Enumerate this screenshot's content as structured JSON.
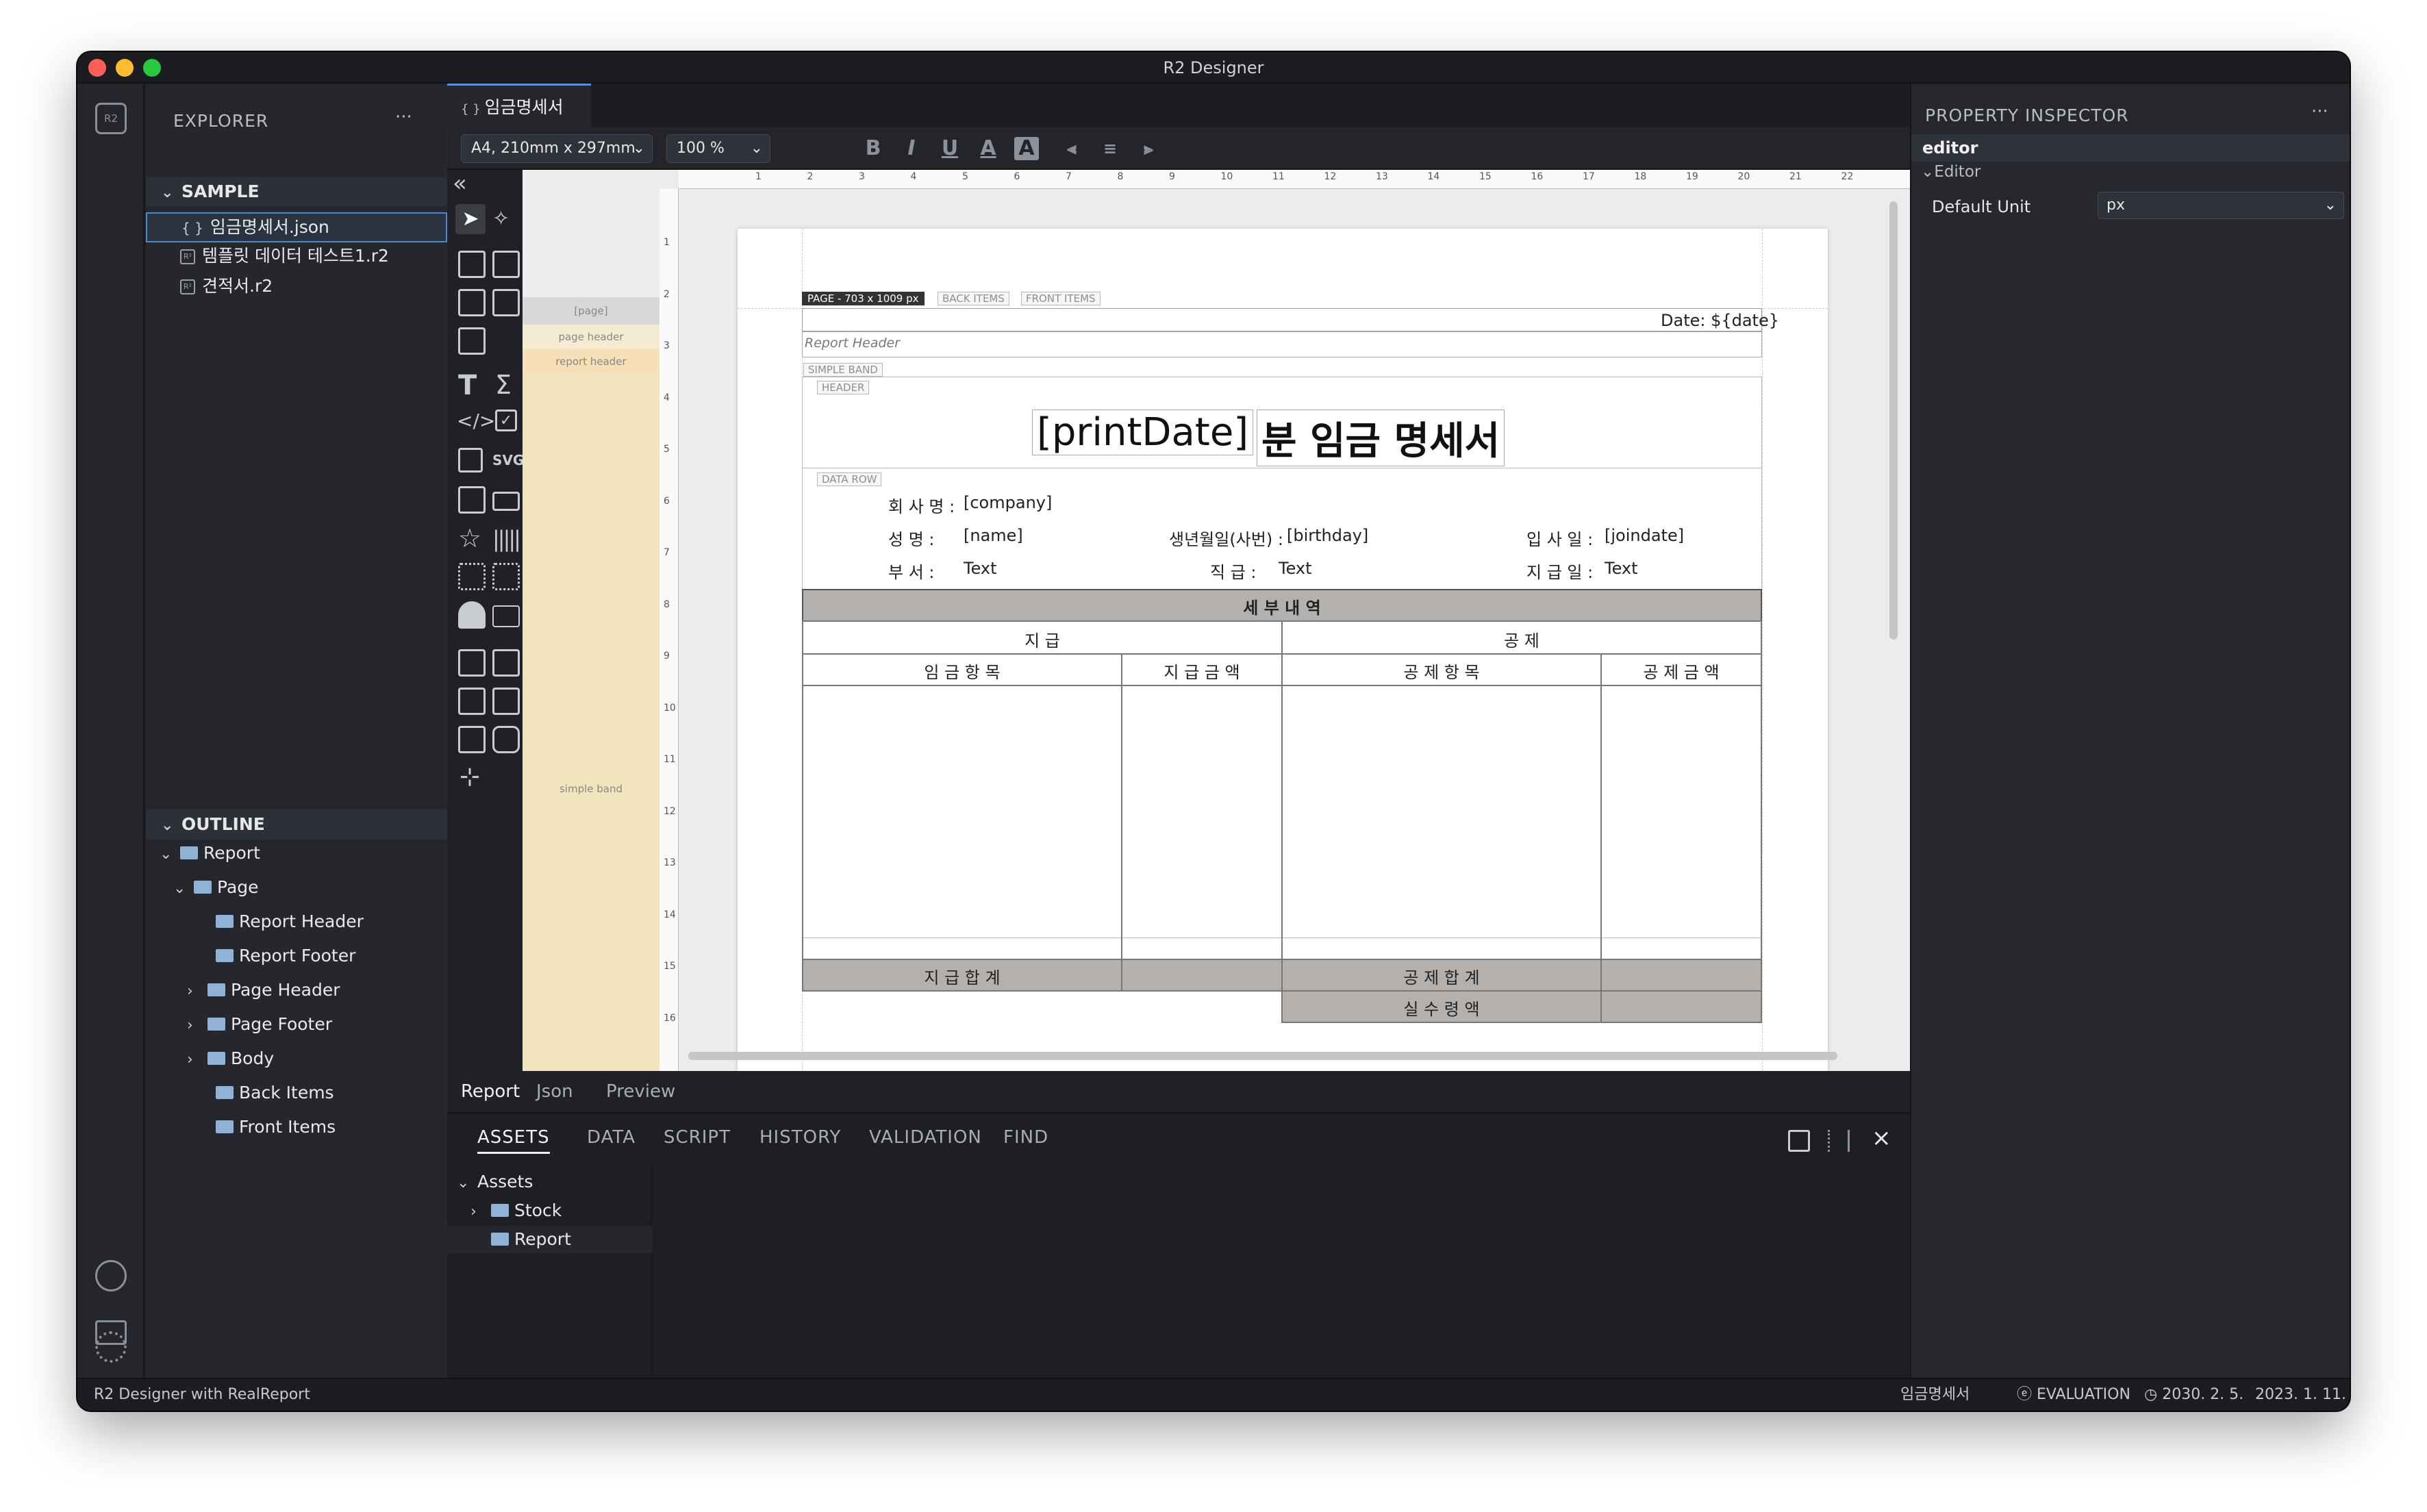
{
  "window": {
    "title": "R2 Designer"
  },
  "explorer": {
    "title": "EXPLORER",
    "more": "···",
    "section": "SAMPLE",
    "files": [
      {
        "name": "임금명세서.json",
        "icon": "json-file-icon",
        "selected": true
      },
      {
        "name": "템플릿 데이터 테스트1.r2",
        "icon": "r2-file-icon"
      },
      {
        "name": "견적서.r2",
        "icon": "r2-file-icon"
      }
    ]
  },
  "outline": {
    "section": "OUTLINE",
    "root": "Report",
    "page": "Page",
    "items": [
      "Report Header",
      "Report Footer",
      "Page Header",
      "Page Footer",
      "Body",
      "Back Items",
      "Front Items"
    ]
  },
  "editor": {
    "tab_label": "임금명세서",
    "tab_prefix": "{ }",
    "tab_close": "×",
    "paper_select": "A4, 210mm x 297mm",
    "zoom": "100 %",
    "collapse": "«"
  },
  "bands": {
    "page": "[page]",
    "page_header": "page header",
    "report_header": "report header",
    "simple_band": "simple band"
  },
  "ruler": {
    "h": [
      "1",
      "2",
      "3",
      "4",
      "5",
      "6",
      "7",
      "8",
      "9",
      "10",
      "11",
      "12",
      "13",
      "14",
      "15",
      "16",
      "17",
      "18",
      "19",
      "20",
      "21",
      "22"
    ],
    "v": [
      "1",
      "2",
      "3",
      "4",
      "5",
      "6",
      "7",
      "8",
      "9",
      "10",
      "11",
      "12",
      "13",
      "14",
      "15",
      "16"
    ]
  },
  "report": {
    "page_label": "PAGE - 703 x 1009 px",
    "back_items": "BACK ITEMS",
    "front_items": "FRONT ITEMS",
    "date": "Date:  ${date}",
    "report_header": "Report Header",
    "simple_band": "SIMPLE BAND",
    "header": "HEADER",
    "title_left": "[printDate]",
    "title_right": "분 임금 명세서",
    "data_row": "DATA ROW",
    "fields": {
      "company_label": "회  사  명 :",
      "company_value": "[company]",
      "name_label": "성      명 :",
      "name_value": "[name]",
      "birthday_label": "생년월일(사번) :",
      "birthday_value": "[birthday]",
      "joindate_label": "입  사  일 :",
      "joindate_value": "[joindate]",
      "dept_label": "부      서 :",
      "dept_value": "Text",
      "position_label": "직       급 :",
      "position_value": "Text",
      "payday_label": "지  급  일 :",
      "payday_value": "Text"
    },
    "table": {
      "section_title": "세 부 내 역",
      "payment": "지      급",
      "deduction": "공      제",
      "cols": [
        "임 금 항 목",
        "지 급 금 액",
        "공 제 항 목",
        "공 제 금 액"
      ],
      "pay_total": "지 급 합 계",
      "deduct_total": "공 제 합 계",
      "net_pay": "실 수 령 액"
    }
  },
  "bottom_tabs": [
    "Report",
    "Json",
    "Preview"
  ],
  "lower_panel": {
    "tabs": [
      "ASSETS",
      "DATA",
      "SCRIPT",
      "HISTORY",
      "VALIDATION",
      "FIND"
    ],
    "tree_root": "Assets",
    "tree_items": [
      "Stock",
      "Report"
    ]
  },
  "inspector": {
    "title": "PROPERTY INSPECTOR",
    "more": "···",
    "object": "editor",
    "group": "Editor",
    "property_label": "Default Unit",
    "property_value": "px"
  },
  "status": {
    "left": "R2 Designer with RealReport",
    "doc": "임금명세서",
    "eval": "EVALUATION",
    "date1": "2030. 2. 5.",
    "date2": "2023. 1. 11."
  },
  "colors": {
    "accent": "#5a8fd8",
    "band_bg": "#f2e5be",
    "table_header": "#b3b0ad"
  }
}
